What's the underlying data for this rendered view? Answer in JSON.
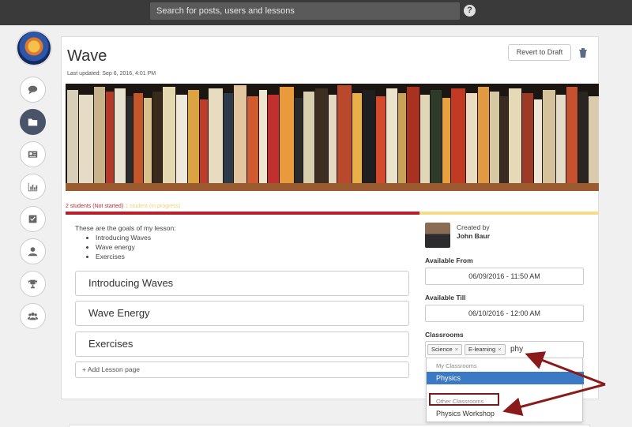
{
  "search": {
    "placeholder": "Search for posts, users and lessons"
  },
  "help": {
    "label": "?"
  },
  "page": {
    "title": "Wave",
    "last_updated": "Last updated: Sep 6, 2016, 4:01 PM",
    "revert_label": "Revert to Draft"
  },
  "progress": {
    "not_started": "2 students (Not started)",
    "in_progress": "1 student (In progress)",
    "colors": {
      "not_started": "#b91f2a",
      "in_progress": "#f5dc8a"
    }
  },
  "goals": {
    "intro": "These are the goals of my lesson:",
    "items": [
      "Introducing Waves",
      "Wave energy",
      "Exercises"
    ]
  },
  "sections": [
    "Introducing Waves",
    "Wave Energy",
    "Exercises"
  ],
  "add_page_label": "+ Add Lesson page",
  "author": {
    "created_by_label": "Created by",
    "name": "John Baur"
  },
  "available_from": {
    "label": "Available From",
    "value": "06/09/2016 - 11:50 AM"
  },
  "available_till": {
    "label": "Available Till",
    "value": "06/10/2016 - 12:00 AM"
  },
  "classrooms": {
    "label": "Classrooms",
    "tags": [
      "Science",
      "E-learning"
    ],
    "typed": "phy",
    "dropdown": {
      "my_label": "My Classrooms",
      "my_items": [
        "Physics"
      ],
      "other_label": "Other Classrooms",
      "other_items": [
        "Physics Workshop"
      ]
    }
  },
  "nav_icons": [
    "comment-icon",
    "folder-icon",
    "newspaper-icon",
    "chart-icon",
    "checkbox-icon",
    "user-icon",
    "trophy-icon",
    "group-icon"
  ]
}
